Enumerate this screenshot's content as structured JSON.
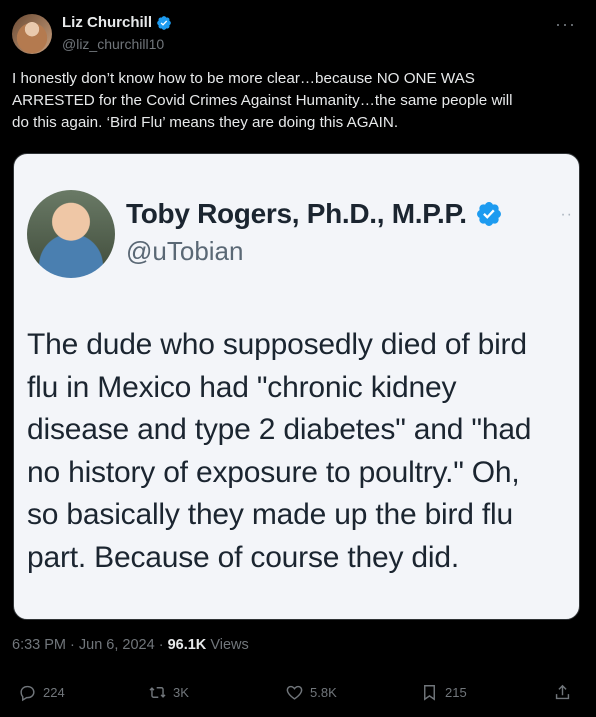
{
  "author": {
    "name": "Liz Churchill",
    "handle": "@liz_churchill10"
  },
  "tweet": {
    "text": "I honestly don’t know how to be more clear…because NO ONE WAS\nARRESTED for the Covid Crimes Against Humanity…the same people will\ndo this again. ‘Bird Flu’ means they are doing this AGAIN."
  },
  "embed": {
    "name": "Toby Rogers, Ph.D., M.P.P.",
    "handle": "@uTobian",
    "text": "The dude who supposedly died of bird\nflu in Mexico had \"chronic kidney\ndisease and type 2 diabetes\" and \"had\nno history of exposure to poultry.\" Oh,\nso basically they made up the bird flu\npart. Because of course they did."
  },
  "meta": {
    "time": "6:33 PM",
    "date": "Jun 6, 2024",
    "separator": " · ",
    "views_count": "96.1K",
    "views_label": "Views"
  },
  "actions": {
    "replies": "224",
    "reposts": "3K",
    "likes": "5.8K",
    "bookmarks": "215"
  },
  "colors": {
    "verified": "#1d9bf0",
    "muted": "#71767b",
    "text": "#e7e9ea",
    "background": "#000000"
  }
}
